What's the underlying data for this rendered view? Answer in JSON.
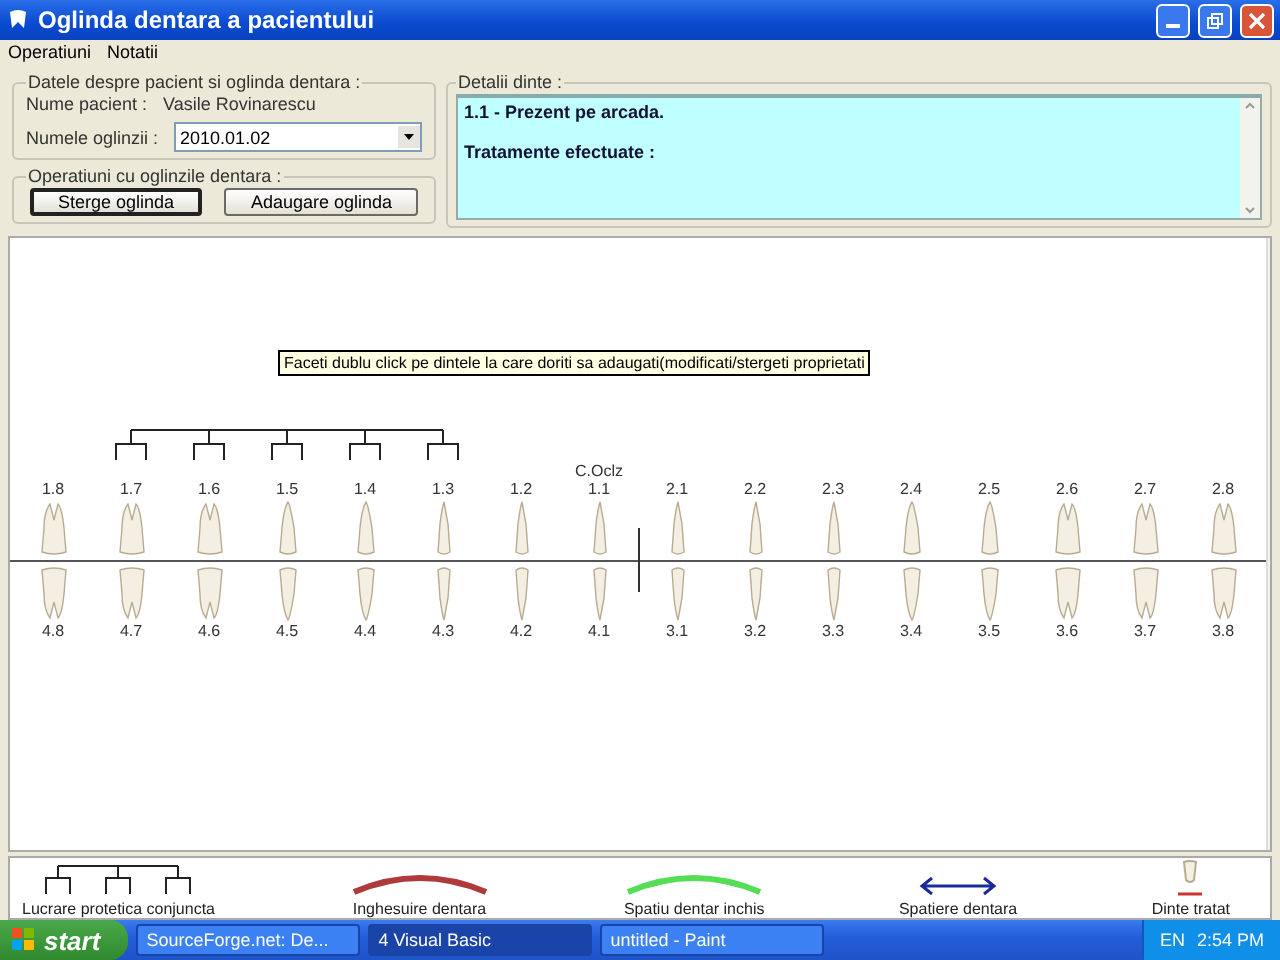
{
  "window": {
    "title": "Oglinda dentara a pacientului"
  },
  "menu": [
    "Operatiuni",
    "Notatii"
  ],
  "patient_group": {
    "title": "Datele despre pacient si oglinda dentara :",
    "name_label": "Nume pacient :",
    "name_value": "Vasile Rovinarescu",
    "mirror_label": "Numele oglinzii :",
    "mirror_value": "2010.01.02"
  },
  "operations_group": {
    "title": "Operatiuni cu oglinzile dentara :",
    "buttons": [
      {
        "label": "Sterge oglinda",
        "focused": true
      },
      {
        "label": "Adaugare oglinda",
        "focused": false
      }
    ]
  },
  "details": {
    "title": "Detalii dinte :",
    "lines": [
      "1.1 - Prezent pe arcada.",
      "Tratamente efectuate :"
    ]
  },
  "hint": "Faceti dublu click pe dintele la care doriti sa adaugati(modificati/stergeti proprietati",
  "upper_teeth": [
    {
      "label": "1.8",
      "kind": "molar",
      "bridge": false
    },
    {
      "label": "1.7",
      "kind": "molar",
      "bridge": true
    },
    {
      "label": "1.6",
      "kind": "molar",
      "bridge": true
    },
    {
      "label": "1.5",
      "kind": "premolar",
      "bridge": true
    },
    {
      "label": "1.4",
      "kind": "premolar",
      "bridge": true
    },
    {
      "label": "1.3",
      "kind": "incisor",
      "bridge": true
    },
    {
      "label": "1.2",
      "kind": "incisor",
      "bridge": false
    },
    {
      "label": "1.1",
      "kind": "incisor",
      "bridge": false,
      "note": "C.Oclz"
    },
    {
      "label": "2.1",
      "kind": "incisor",
      "bridge": false
    },
    {
      "label": "2.2",
      "kind": "incisor",
      "bridge": false
    },
    {
      "label": "2.3",
      "kind": "incisor",
      "bridge": false
    },
    {
      "label": "2.4",
      "kind": "premolar",
      "bridge": false
    },
    {
      "label": "2.5",
      "kind": "premolar",
      "bridge": false
    },
    {
      "label": "2.6",
      "kind": "molar",
      "bridge": false
    },
    {
      "label": "2.7",
      "kind": "molar",
      "bridge": false
    },
    {
      "label": "2.8",
      "kind": "molar",
      "bridge": false
    }
  ],
  "lower_teeth": [
    {
      "label": "4.8",
      "kind": "molar"
    },
    {
      "label": "4.7",
      "kind": "molar"
    },
    {
      "label": "4.6",
      "kind": "molar"
    },
    {
      "label": "4.5",
      "kind": "premolar"
    },
    {
      "label": "4.4",
      "kind": "premolar"
    },
    {
      "label": "4.3",
      "kind": "incisor"
    },
    {
      "label": "4.2",
      "kind": "incisor"
    },
    {
      "label": "4.1",
      "kind": "incisor"
    },
    {
      "label": "3.1",
      "kind": "incisor"
    },
    {
      "label": "3.2",
      "kind": "incisor"
    },
    {
      "label": "3.3",
      "kind": "incisor"
    },
    {
      "label": "3.4",
      "kind": "premolar"
    },
    {
      "label": "3.5",
      "kind": "premolar"
    },
    {
      "label": "3.6",
      "kind": "molar"
    },
    {
      "label": "3.7",
      "kind": "molar"
    },
    {
      "label": "3.8",
      "kind": "molar"
    }
  ],
  "legend": [
    {
      "kind": "bridge",
      "label": "Lucrare protetica conjuncta"
    },
    {
      "kind": "arc",
      "label": "Inghesuire dentara",
      "color": "#b03a3a"
    },
    {
      "kind": "arc",
      "label": "Spatiu dentar inchis",
      "color": "#55dd55"
    },
    {
      "kind": "arrow",
      "label": "Spatiere dentara"
    },
    {
      "kind": "tooth",
      "label": "Dinte tratat"
    }
  ],
  "taskbar": {
    "start": "start",
    "tasks": [
      {
        "label": "SourceForge.net: De...",
        "selected": false
      },
      {
        "label": "4 Visual Basic",
        "selected": true
      },
      {
        "label": "untitled - Paint",
        "selected": false
      }
    ],
    "language": "EN",
    "time": "2:54 PM"
  }
}
